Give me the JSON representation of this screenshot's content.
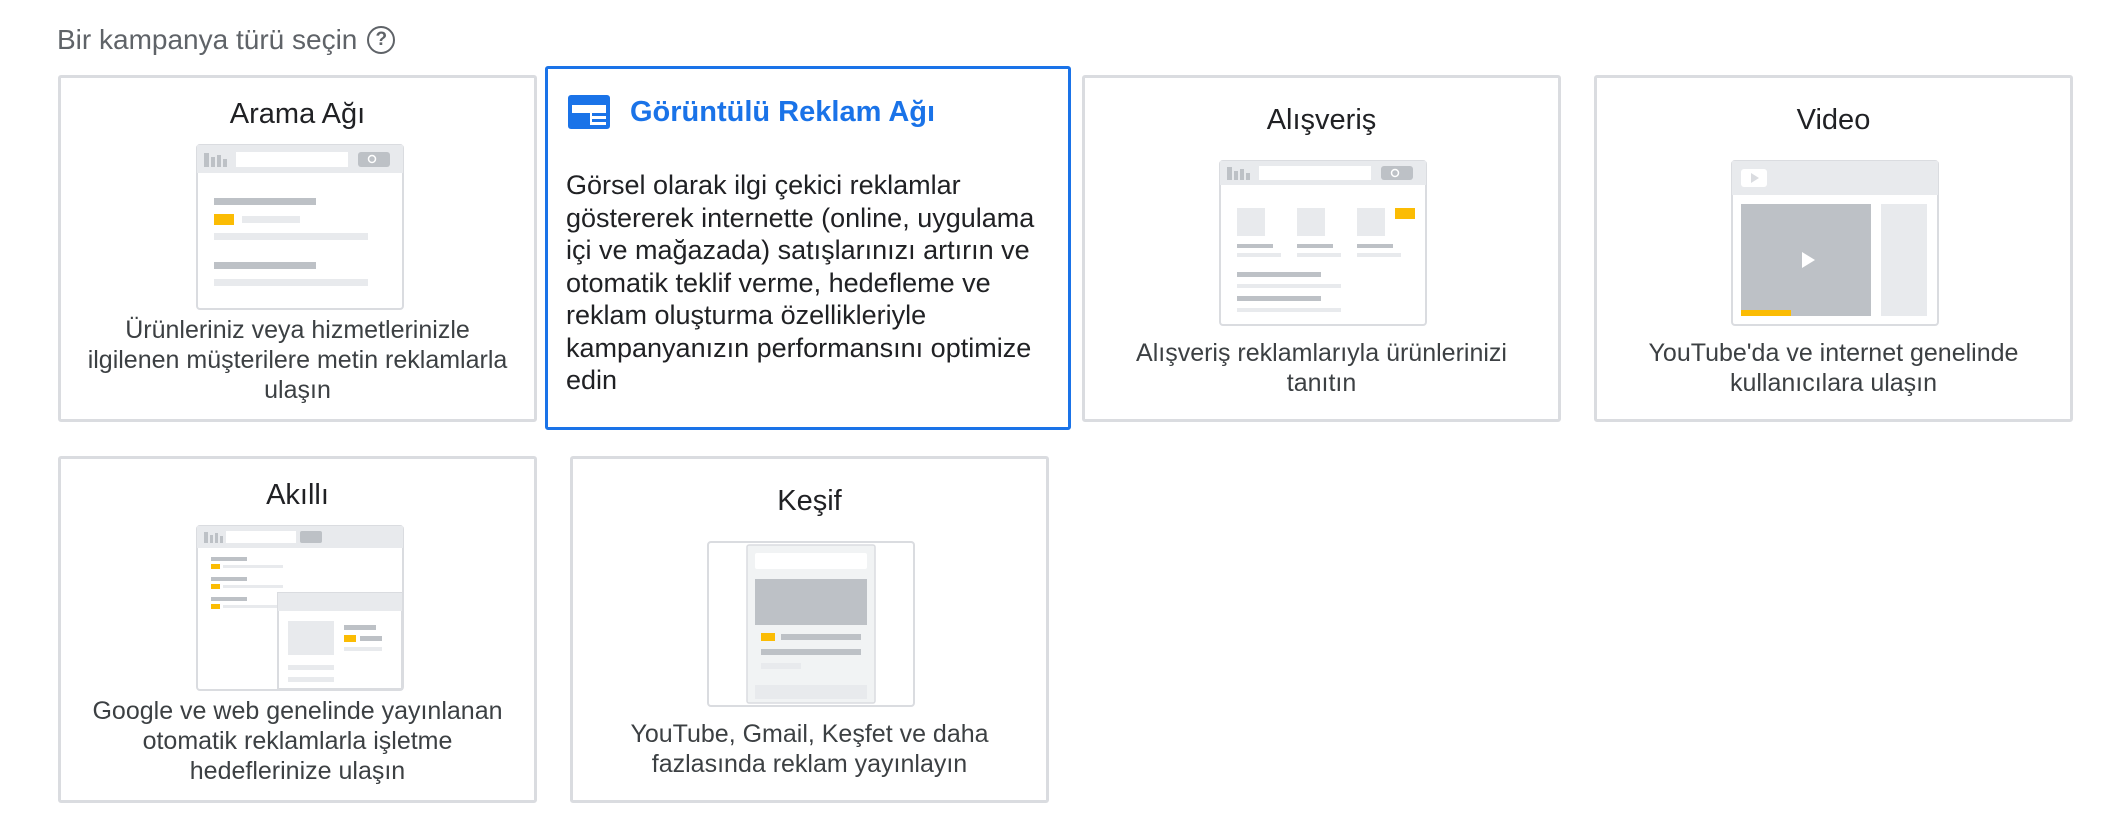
{
  "header": {
    "title": "Bir kampanya türü seçin",
    "help_icon": "help-circle-icon"
  },
  "cards": [
    {
      "id": "search",
      "title": "Arama Ağı",
      "description": "Ürünleriniz veya hizmetlerinizle ilgilenen müşterilere metin reklamlarla ulaşın",
      "selected": false
    },
    {
      "id": "display",
      "title": "Görüntülü Reklam Ağı",
      "description": "Görsel olarak ilgi çekici reklamlar göstererek internette (online, uygulama içi ve mağazada) satışlarınızı artırın ve otomatik teklif verme, hedefleme ve reklam oluşturma özellikleriyle kampanyanızın performansını optimize edin",
      "selected": true,
      "icon": "display-ad-icon"
    },
    {
      "id": "shopping",
      "title": "Alışveriş",
      "description": "Alışveriş reklamlarıyla ürünlerinizi tanıtın",
      "selected": false
    },
    {
      "id": "video",
      "title": "Video",
      "description": "YouTube'da ve internet genelinde kullanıcılara ulaşın",
      "selected": false
    },
    {
      "id": "smart",
      "title": "Akıllı",
      "description": "Google ve web genelinde yayınlanan otomatik reklamlarla işletme hedeflerinize ulaşın",
      "selected": false
    },
    {
      "id": "discovery",
      "title": "Keşif",
      "description": "YouTube, Gmail, Keşfet ve daha fazlasında reklam yayınlayın",
      "selected": false
    }
  ],
  "colors": {
    "accent": "#1a73e8",
    "highlight": "#fbbc04",
    "border": "#dadce0"
  }
}
